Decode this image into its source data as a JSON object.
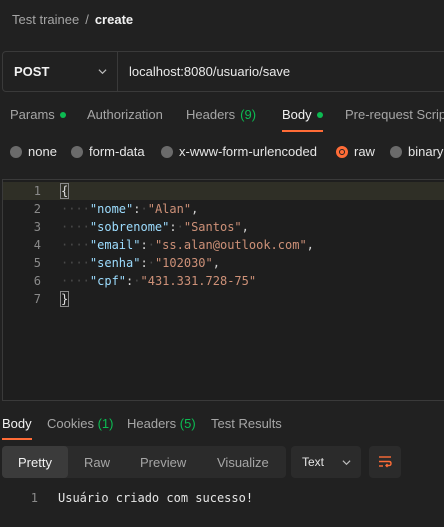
{
  "breadcrumb": {
    "parent": "Test trainee",
    "separator": "/",
    "current": "create"
  },
  "request": {
    "method": "POST",
    "url": "localhost:8080/usuario/save"
  },
  "request_tabs": [
    {
      "label": "Params",
      "indicator": "dot"
    },
    {
      "label": "Authorization"
    },
    {
      "label": "Headers",
      "count": "(9)"
    },
    {
      "label": "Body",
      "indicator": "dot",
      "active": true
    },
    {
      "label": "Pre-request Script"
    }
  ],
  "body_modes": [
    {
      "label": "none"
    },
    {
      "label": "form-data"
    },
    {
      "label": "x-www-form-urlencoded"
    },
    {
      "label": "raw",
      "selected": true
    },
    {
      "label": "binary"
    }
  ],
  "editor": {
    "line_numbers": [
      "1",
      "2",
      "3",
      "4",
      "5",
      "6",
      "7"
    ],
    "open_brace": "{",
    "close_brace": "}",
    "fields": [
      {
        "key": "\"nome\"",
        "value": "\"Alan\""
      },
      {
        "key": "\"sobrenome\"",
        "value": "\"Santos\""
      },
      {
        "key": "\"email\"",
        "value": "\"ss.alan@outlook.com\""
      },
      {
        "key": "\"senha\"",
        "value": "\"102030\""
      },
      {
        "key": "\"cpf\"",
        "value": "\"431.331.728-75\""
      }
    ]
  },
  "response_tabs": [
    {
      "label": "Body",
      "active": true
    },
    {
      "label": "Cookies",
      "count": "(1)"
    },
    {
      "label": "Headers",
      "count": "(5)"
    },
    {
      "label": "Test Results"
    }
  ],
  "views": [
    "Pretty",
    "Raw",
    "Preview",
    "Visualize"
  ],
  "format": "Text",
  "response": {
    "line_number": "1",
    "text": "Usuário criado com sucesso!"
  },
  "colors": {
    "accent": "#ff6c37",
    "green": "#0cbb52",
    "key": "#9cdcfe",
    "string": "#ce9178"
  },
  "icons": [
    "chevron-down-icon",
    "wrap-lines-icon"
  ]
}
